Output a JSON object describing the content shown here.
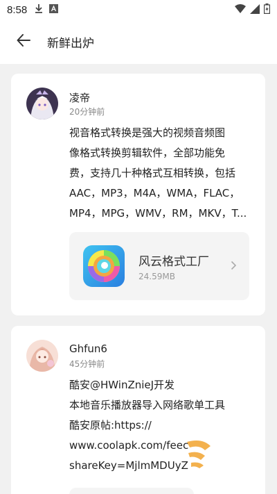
{
  "status_bar": {
    "time": "8:58"
  },
  "header": {
    "title": "新鲜出炉"
  },
  "posts": [
    {
      "username": "凌帝",
      "time": "20分钟前",
      "text_lines": [
        "视音格式转换是强大的视频音频图",
        "像格式转换剪辑软件，全部功能免",
        "费，支持几十种格式互相转换，包括",
        "AAC，MP3，M4A，WMA，FLAC，",
        "MP4，MPG，WMV，RM，MKV，T..."
      ],
      "app": {
        "name": "风云格式工厂",
        "size": "24.59MB"
      }
    },
    {
      "username": "Ghfun6",
      "time": "45分钟前",
      "text_lines": [
        "酷安@HWinZnieJ开发",
        "本地音乐播放器导入网络歌单工具",
        "酷安原帖:https://",
        "www.coolapk.com/feec",
        "shareKey=MjlmMDUyZ"
      ]
    }
  ],
  "colors": {
    "background": "#f1f1f1",
    "card": "#ffffff",
    "secondary_text": "#888888"
  }
}
